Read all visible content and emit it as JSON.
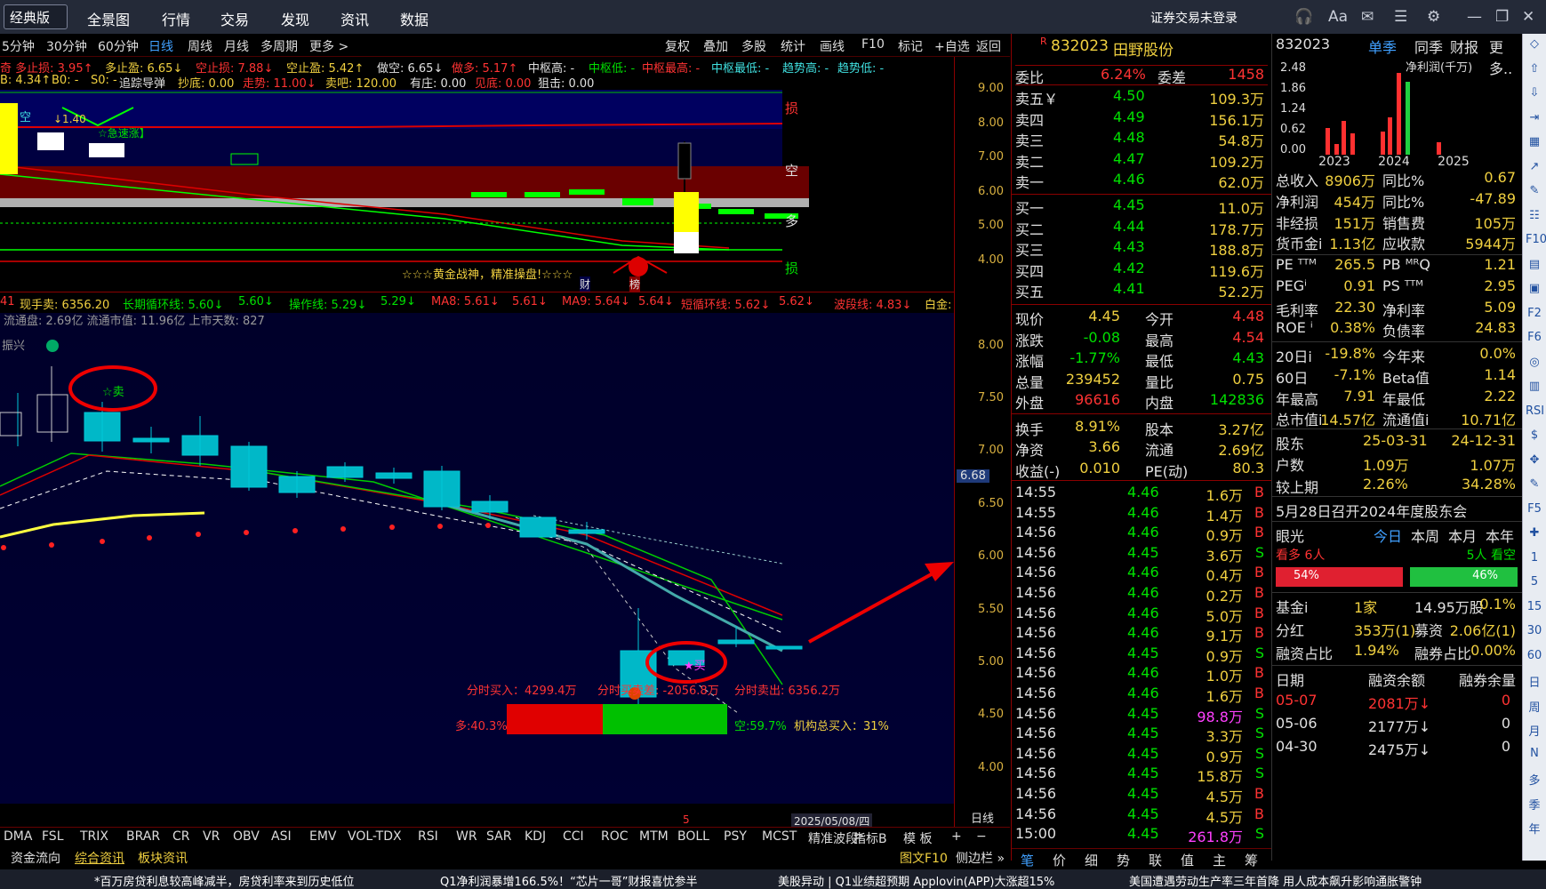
{
  "topbar": {
    "edition": "经典版",
    "menu": [
      "全景图",
      "行情",
      "交易",
      "发现",
      "资讯",
      "数据"
    ],
    "login": "证券交易未登录",
    "icons": [
      "headset-icon",
      "font-icon",
      "mail-icon",
      "list-icon",
      "gear-icon",
      "minimize-icon",
      "restore-icon",
      "close-icon"
    ]
  },
  "periods": [
    "5分钟",
    "30分钟",
    "60分钟",
    "日线",
    "周线",
    "月线",
    "多周期",
    "更多 >"
  ],
  "toolbar": [
    "复权",
    "叠加",
    "多股",
    "统计",
    "画线",
    "F10",
    "标记",
    "+自选",
    "返回"
  ],
  "ind1": [
    "奇 多止损: 3.95↑",
    "多止盈: 6.65↓",
    "空止损: 7.88↓",
    "空止盈: 5.42↑",
    "做空: 6.65↓",
    "做多: 5.17↑",
    "中枢高: -",
    "中枢低: -",
    "中枢最高: -",
    "中枢最低: -",
    "趋势高: -",
    "趋势低: -"
  ],
  "ind2": [
    "B: 4.34↑",
    "B0: -",
    "S0: -",
    "追踪导弹",
    "抄底: 0.00",
    "走势: 11.00↓",
    "卖吧: 120.00",
    "有庄: 0.00",
    "见底: 0.00",
    "狙击: 0.00"
  ],
  "upper": {
    "labels": {
      "sun": "损",
      "kong": "空",
      "duo": "多",
      "sun2": "损",
      "golden": "☆☆☆黄金战神，精准操盘!☆☆☆",
      "cai": "财",
      "bang": "榜",
      "kong2": "空",
      "z140": "↓1.40",
      "sudu": "☆急速涨】"
    },
    "axis": [
      "9.00",
      "8.00",
      "7.00",
      "6.00",
      "5.00",
      "4.00"
    ]
  },
  "ind3": [
    "41",
    "现手卖: 6356.20",
    "长期循环线: 5.60↓",
    "5.60↓",
    "操作线: 5.29↓",
    "5.29↓",
    "MA8: 5.61↓",
    "5.61↓",
    "MA9: 5.64↓",
    "5.64↓",
    "短循环线: 5.62↓",
    "5.62↓",
    "波段线: 4.83↓",
    "白金:"
  ],
  "lower": {
    "info": "流通盘: 2.69亿 流通市值: 11.96亿 上市天数: 827",
    "zhenxing": "振兴",
    "sell": "☆卖",
    "buy": "★买",
    "fen": [
      "分时买入：4299.4万",
      "分时买卖差: -2056.8万",
      "分时卖出: 6356.2万"
    ],
    "duo": "多:40.3%",
    "kong": "空:59.7%",
    "jigou": "机构总买入：31%",
    "date": "2025/05/08/四",
    "cursor": "5",
    "axis": [
      "8.00",
      "7.50",
      "7.00",
      "6.50",
      "6.00",
      "5.50",
      "5.00",
      "4.50",
      "4.00"
    ],
    "marker": "6.68",
    "period": "日线"
  },
  "quote": {
    "code": "832023",
    "name": "田野股份",
    "ratio": [
      "委比",
      "6.24%",
      "委差",
      "1458"
    ],
    "asks": [
      [
        "卖五￥",
        "4.50",
        "109.3万"
      ],
      [
        "卖四",
        "4.49",
        "156.1万"
      ],
      [
        "卖三",
        "4.48",
        "54.8万"
      ],
      [
        "卖二",
        "4.47",
        "109.2万"
      ],
      [
        "卖一",
        "4.46",
        "62.0万"
      ]
    ],
    "bids": [
      [
        "买一",
        "4.45",
        "11.0万"
      ],
      [
        "买二",
        "4.44",
        "178.7万"
      ],
      [
        "买三",
        "4.43",
        "188.8万"
      ],
      [
        "买四",
        "4.42",
        "119.6万"
      ],
      [
        "买五",
        "4.41",
        "52.2万"
      ]
    ],
    "stats": [
      [
        "现价",
        "4.45",
        "今开",
        "4.48"
      ],
      [
        "涨跌",
        "-0.08",
        "最高",
        "4.54"
      ],
      [
        "涨幅",
        "-1.77%",
        "最低",
        "4.43"
      ],
      [
        "总量",
        "239452",
        "量比",
        "0.75"
      ],
      [
        "外盘",
        "96616",
        "内盘",
        "142836"
      ],
      [
        "换手",
        "8.91%",
        "股本",
        "3.27亿"
      ],
      [
        "净资",
        "3.66",
        "流通",
        "2.69亿"
      ],
      [
        "收益(-)",
        "0.010",
        "PE(动)",
        "80.3"
      ]
    ],
    "ticks": [
      [
        "14:55",
        "4.46",
        "1.6万",
        "B"
      ],
      [
        "14:55",
        "4.46",
        "1.4万",
        "B"
      ],
      [
        "14:56",
        "4.46",
        "0.9万",
        "B"
      ],
      [
        "14:56",
        "4.45",
        "3.6万",
        "S"
      ],
      [
        "14:56",
        "4.46",
        "0.4万",
        "B"
      ],
      [
        "14:56",
        "4.46",
        "0.2万",
        "B"
      ],
      [
        "14:56",
        "4.46",
        "5.0万",
        "B"
      ],
      [
        "14:56",
        "4.46",
        "9.1万",
        "B"
      ],
      [
        "14:56",
        "4.45",
        "0.9万",
        "S"
      ],
      [
        "14:56",
        "4.46",
        "1.0万",
        "B"
      ],
      [
        "14:56",
        "4.46",
        "1.6万",
        "B"
      ],
      [
        "14:56",
        "4.45",
        "98.8万",
        "S"
      ],
      [
        "14:56",
        "4.45",
        "3.3万",
        "S"
      ],
      [
        "14:56",
        "4.45",
        "0.9万",
        "S"
      ],
      [
        "14:56",
        "4.45",
        "15.8万",
        "S"
      ],
      [
        "14:56",
        "4.45",
        "4.5万",
        "B"
      ],
      [
        "14:56",
        "4.45",
        "4.5万",
        "B"
      ],
      [
        "15:00",
        "4.45",
        "261.8万",
        "S"
      ]
    ],
    "bottomtabs": [
      "笔",
      "价",
      "细",
      "势",
      "联",
      "值",
      "主",
      "筹"
    ]
  },
  "info": {
    "code": "832023",
    "tabs": [
      "单季",
      "同季",
      "财报",
      "更多.."
    ],
    "yaxis": [
      "2.48",
      "1.86",
      "1.24",
      "0.62",
      "0.00"
    ],
    "legend": "净利润(千万)",
    "years": [
      "2023",
      "2024",
      "2025"
    ],
    "rows1": [
      [
        "总收入",
        "8906万",
        "同比%",
        "0.67"
      ],
      [
        "净利润",
        "454万",
        "同比%",
        "-47.89"
      ],
      [
        "非经损",
        "151万",
        "销售费",
        "105万"
      ],
      [
        "货币金i",
        "1.13亿",
        "应收款",
        "5944万"
      ]
    ],
    "rows2": [
      [
        "PE ᵀᵀᴹ",
        "265.5",
        "PB ᴹᴿQ",
        "1.21"
      ],
      [
        "PEGⁱ",
        "0.91",
        "PS ᵀᵀᴹ",
        "2.95"
      ],
      [
        "毛利率",
        "22.30",
        "净利率",
        "5.09"
      ],
      [
        "ROE ⁱ",
        "0.38%",
        "负债率",
        "24.83"
      ]
    ],
    "rows3": [
      [
        "20日i",
        "-19.8%",
        "今年来",
        "0.0%"
      ],
      [
        "60日",
        "-7.1%",
        "Beta值",
        "1.14"
      ],
      [
        "年最高",
        "7.91",
        "年最低",
        "2.22"
      ],
      [
        "总市值i",
        "14.57亿",
        "流通值i",
        "10.71亿"
      ]
    ],
    "rows4": [
      [
        "股东",
        "25-03-31",
        "24-12-31"
      ],
      [
        "户数",
        "1.09万",
        "1.07万"
      ],
      [
        "较上期",
        "2.26%",
        "34.28%"
      ]
    ],
    "notice": "5月28日召开2024年度股东会",
    "yanguang": {
      "title": "眼光",
      "tabs": [
        "今日",
        "本周",
        "本月",
        "本年"
      ],
      "kandu": "看多 6人",
      "kankong": "5人 看空",
      "pct1": "54%",
      "pct2": "46%"
    },
    "rows5": [
      [
        "基金i",
        "1家",
        "14.95万股",
        "0.1%"
      ],
      [
        "分红",
        "353万(1)",
        "募资",
        "2.06亿(1)"
      ],
      [
        "融资占比",
        "1.94%",
        "融券占比",
        "0.00%"
      ]
    ],
    "margin_head": [
      "日期",
      "融资余额",
      "融券余量"
    ],
    "margin": [
      [
        "05-07",
        "2081万↓",
        "0"
      ],
      [
        "05-06",
        "2177万↓",
        "0"
      ],
      [
        "04-30",
        "2475万↓",
        "0"
      ]
    ]
  },
  "sidetools": [
    "◇",
    "⇧",
    "⇩",
    "⇥",
    "▦",
    "↗",
    "✎",
    "☷",
    "F10",
    "▤",
    "▣",
    "F2",
    "F6",
    "◎",
    "▥",
    "RSI",
    "$",
    "✥",
    "✎",
    "F5",
    "✚",
    "1",
    "5",
    "15",
    "30",
    "60",
    "日",
    "周",
    "月",
    "N",
    "多",
    "季",
    "年"
  ],
  "indtabs": [
    "DMA",
    "FSL",
    "TRIX",
    "BRAR",
    "CR",
    "VR",
    "OBV",
    "ASI",
    "EMV",
    "VOL-TDX",
    "RSI",
    "WR",
    "SAR",
    "KDJ",
    "CCI",
    "ROC",
    "MTM",
    "BOLL",
    "PSY",
    "MCST",
    "精准波段",
    ">",
    "指标B",
    "模 板",
    "+",
    "−"
  ],
  "tabs2": [
    "资金流向",
    "综合资讯",
    "板块资讯"
  ],
  "tabs2right": [
    "图文F10",
    "侧边栏 »"
  ],
  "ticker": [
    "*百万房贷利息较高峰减半，房贷利率来到历史低位",
    "Q1净利润暴增166.5%！“芯片一哥”财报喜忧参半",
    "美股异动 | Q1业绩超预期 Applovin(APP)大涨超15%",
    "美国遭遇劳动生产率三年首降 用人成本飙升影响通胀警钟"
  ]
}
